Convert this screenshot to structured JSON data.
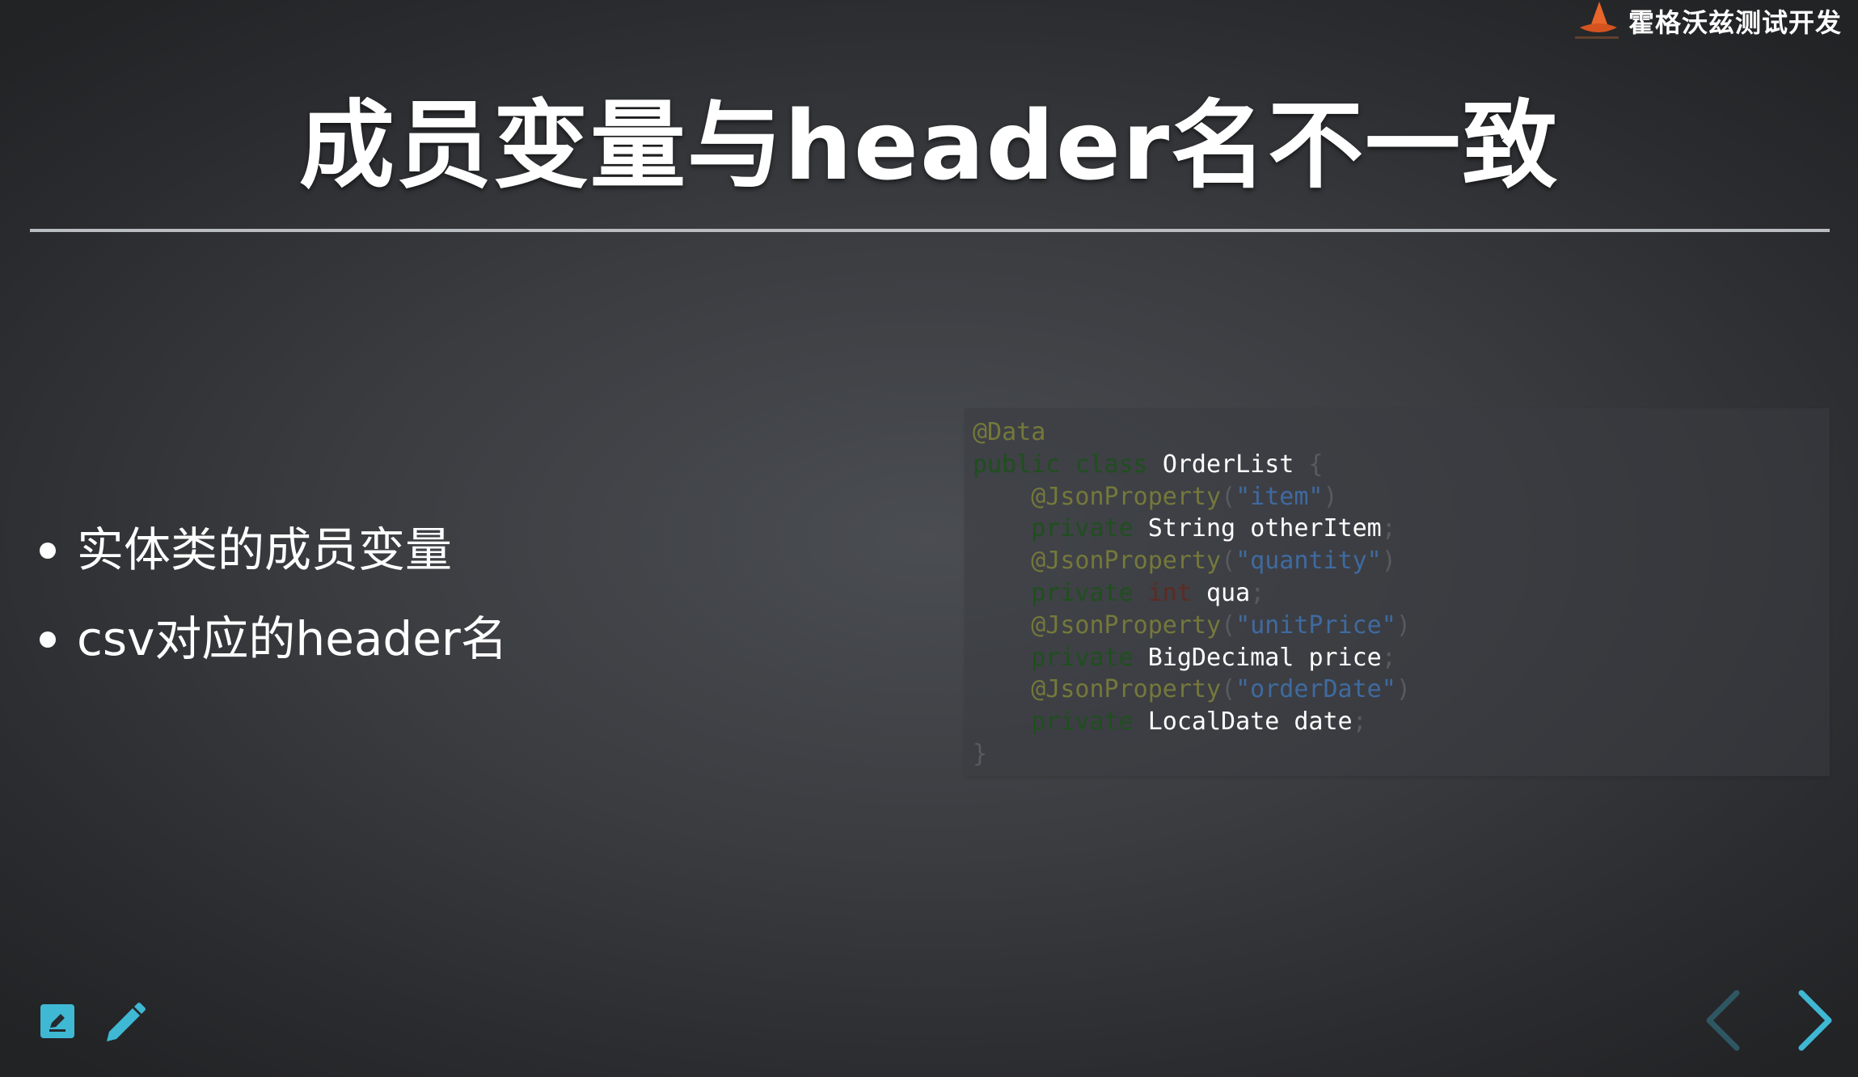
{
  "brand": {
    "name": "霍格沃兹测试开发",
    "logo_icon": "wizard-hat-logo-icon"
  },
  "slide": {
    "title": "成员变量与header名不一致",
    "bullets": [
      "实体类的成员变量",
      "csv对应的header名"
    ]
  },
  "code": {
    "annotation_data": "@Data",
    "kw_public": "public",
    "kw_class": "class",
    "class_name": "OrderList",
    "brace_open": "{",
    "brace_close": "}",
    "json_property": "@JsonProperty",
    "paren_open": "(",
    "paren_close": ")",
    "kw_private": "private",
    "semicolon": ";",
    "fields": [
      {
        "key": "\"item\"",
        "type": "String",
        "name": "otherItem"
      },
      {
        "key": "\"quantity\"",
        "type": "int",
        "name": "qua"
      },
      {
        "key": "\"unitPrice\"",
        "type": "BigDecimal",
        "name": "price"
      },
      {
        "key": "\"orderDate\"",
        "type": "LocalDate",
        "name": "date"
      }
    ]
  },
  "toolbar": {
    "notes_icon": "notes-icon",
    "pen_icon": "pen-icon",
    "prev_icon": "chevron-left-icon",
    "next_icon": "chevron-right-icon"
  },
  "colors": {
    "accent": "#3fb8d4",
    "nav_prev": "#2f5763",
    "nav_next": "#3fb8d4",
    "annotation": "#75783a",
    "keyword": "#1f4f1e",
    "string": "#3f6aa0",
    "primitive": "#5e2a22"
  }
}
